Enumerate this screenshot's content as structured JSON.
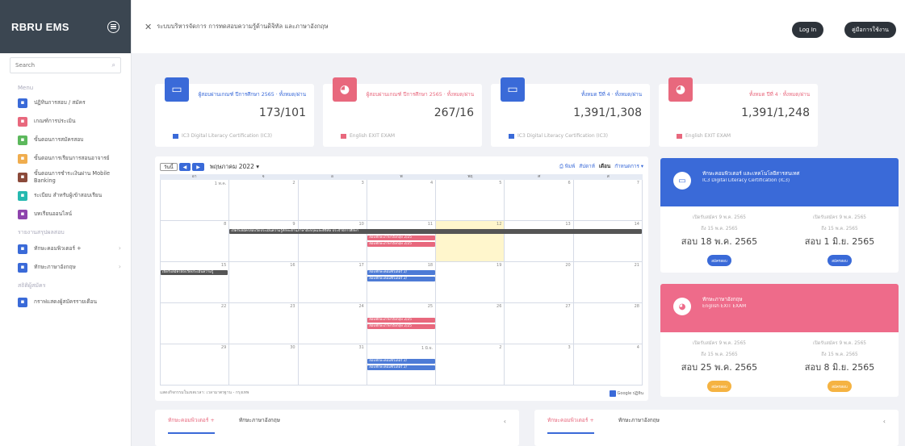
{
  "app": {
    "brand": "RBRU EMS",
    "title": "ระบบบริหารจัดการ การทดสอบความรู้ด้านดิจิทัล และภาษาอังกฤษ",
    "login": "Log In",
    "manual": "คู่มือการใช้งาน"
  },
  "sidebar": {
    "search_placeholder": "Search",
    "menu_label": "Menu",
    "items": [
      {
        "label": "ปฏิทินการสอบ / สมัคร",
        "color": "#3a6ad8"
      },
      {
        "label": "เกณฑ์การประเมิน",
        "color": "#e8687d"
      },
      {
        "label": "ขั้นตอนการสมัครสอบ",
        "color": "#5cb85c"
      },
      {
        "label": "ขั้นตอนการเรียนการสอนอาจารย์",
        "color": "#f0ad4e"
      },
      {
        "label": "ขั้นตอนการชำระเงินผ่าน Mobile Banking",
        "color": "#8b4a3a"
      },
      {
        "label": "ระเบียบ สำหรับผู้เข้าสอบเรียน",
        "color": "#26b9b0"
      },
      {
        "label": "บทเรียนออนไลน์",
        "color": "#8e44ad"
      }
    ],
    "section2": "รายงานสรุปผลสอบ",
    "items2": [
      {
        "label": "ทักษะคอมพิวเตอร์ +",
        "color": "#3a6ad8"
      },
      {
        "label": "ทักษะภาษาอังกฤษ",
        "color": "#3a6ad8"
      }
    ],
    "section3": "สถิติผู้สมัคร",
    "items3": [
      {
        "label": "กราฟแสดงผู้สมัครรายเดือน",
        "color": "#3a6ad8"
      }
    ]
  },
  "stats": [
    {
      "label": "ผู้สอบผ่านเกณฑ์ ปีการศึกษา 2565 · ทั้งหมด/ผ่าน",
      "value": "173/101",
      "foot": "IC3 Digital Literacy Certification (IC3)",
      "color": "#3a6ad8",
      "icon": "monitor-icon"
    },
    {
      "label": "ผู้สอบผ่านเกณฑ์ ปีการศึกษา 2565 · ทั้งหมด/ผ่าน",
      "value": "267/16",
      "foot": "English EXIT EXAM",
      "color": "#e8687d",
      "icon": "globe-icon"
    },
    {
      "label": "ทั้งหมด ปีที่ 4 · ทั้งหมด/ผ่าน",
      "value": "1,391/1,308",
      "foot": "IC3 Digital Literacy Certification (IC3)",
      "color": "#3a6ad8",
      "icon": "monitor-icon"
    },
    {
      "label": "ทั้งหมด ปีที่ 4 · ทั้งหมด/ผ่าน",
      "value": "1,391/1,248",
      "foot": "English EXIT EXAM",
      "color": "#e8687d",
      "icon": "globe-icon"
    }
  ],
  "calendar": {
    "today_btn": "วันนี้",
    "month": "พฤษภาคม 2022",
    "views": [
      "พิมพ์",
      "สัปดาห์",
      "เดือน",
      "กำหนดการ"
    ],
    "days": [
      "อา",
      "จ",
      "อ",
      "พ",
      "พฤ",
      "ศ",
      "ส"
    ],
    "weeks": [
      [
        "1 พ.ค.",
        "2",
        "3",
        "4",
        "5",
        "6",
        "7"
      ],
      [
        "8",
        "9",
        "10",
        "11",
        "12",
        "13",
        "14"
      ],
      [
        "15",
        "16",
        "17",
        "18",
        "19",
        "20",
        "21"
      ],
      [
        "22",
        "23",
        "24",
        "25",
        "26",
        "27",
        "28"
      ],
      [
        "29",
        "30",
        "31",
        "1 มิ.ย.",
        "2",
        "3",
        "4"
      ]
    ],
    "events": [
      {
        "w": 1,
        "s": 1,
        "e": 7,
        "t": "เปิดรับสมัครสอบวัดประเมินความรู้ทักษะด้านภาษาอังกฤษและดิจิทัล ประจำปีการศึกษา",
        "c": "g"
      },
      {
        "w": 1,
        "s": 3,
        "e": 4,
        "t": "สอบทักษะภาษาอังกฤษ 2/25",
        "c": "p",
        "r": 1
      },
      {
        "w": 1,
        "s": 3,
        "e": 4,
        "t": "สอบทักษะภาษาอังกฤษ 2/25",
        "c": "p",
        "r": 2
      },
      {
        "w": 2,
        "s": 0,
        "e": 1,
        "t": "เปิดรับสมัครสอบวัดประเมินความรู้",
        "c": "g"
      },
      {
        "w": 2,
        "s": 3,
        "e": 4,
        "t": "สอบทักษะคอมพิวเตอร์ 2/",
        "c": "b"
      },
      {
        "w": 2,
        "s": 3,
        "e": 4,
        "t": "สอบทักษะคอมพิวเตอร์ 2/",
        "c": "b",
        "r": 1
      },
      {
        "w": 3,
        "s": 3,
        "e": 4,
        "t": "สอบทักษะภาษาอังกฤษ 2/25",
        "c": "p",
        "r": 1
      },
      {
        "w": 3,
        "s": 3,
        "e": 4,
        "t": "สอบทักษะภาษาอังกฤษ 2/25",
        "c": "p",
        "r": 2
      },
      {
        "w": 4,
        "s": 3,
        "e": 4,
        "t": "สอบทักษะคอมพิวเตอร์ 2/",
        "c": "b",
        "r": 1
      },
      {
        "w": 4,
        "s": 3,
        "e": 4,
        "t": "สอบทักษะคอมพิวเตอร์ 2/",
        "c": "b",
        "r": 2
      }
    ],
    "foot": "แสดงกิจกรรมในเขตเวลา: เวลามาตรฐาน - กรุงเทพ",
    "gcal": "Google ปฏิทิน"
  },
  "exams": [
    {
      "title": "ทักษะคอมพิวเตอร์ และเทคโนโลยีสารสนเทศ",
      "sub": "IC3 Digital Literacy Certification (IC3)",
      "color": "#3a6ad8",
      "icon": "monitor-icon",
      "rounds": [
        {
          "a": "เปิดรับสมัคร 9 พ.ค. 2565",
          "b": "ถึง 15 พ.ค. 2565",
          "c": "สอบ 18 พ.ค. 2565",
          "btn": "สมัครสอบ"
        },
        {
          "a": "เปิดรับสมัคร 9 พ.ค. 2565",
          "b": "ถึง 15 พ.ค. 2565",
          "c": "สอบ 1 มิ.ย. 2565",
          "btn": "สมัครสอบ"
        }
      ]
    },
    {
      "title": "ทักษะภาษาอังกฤษ",
      "sub": "English EXIT EXAM",
      "color": "#ee6b8a",
      "icon": "globe-icon",
      "btncolor": "#f5b342",
      "rounds": [
        {
          "a": "เปิดรับสมัคร 9 พ.ค. 2565",
          "b": "ถึง 15 พ.ค. 2565",
          "c": "สอบ 25 พ.ค. 2565",
          "btn": "สมัครสอบ"
        },
        {
          "a": "เปิดรับสมัคร 9 พ.ค. 2565",
          "b": "ถึง 15 พ.ค. 2565",
          "c": "สอบ 8 มิ.ย. 2565",
          "btn": "สมัครสอบ"
        }
      ]
    }
  ],
  "tabs": [
    [
      "ทักษะคอมพิวเตอร์ +",
      "ทักษะภาษาอังกฤษ"
    ],
    [
      "ทักษะคอมพิวเตอร์ +",
      "ทักษะภาษาอังกฤษ"
    ]
  ]
}
